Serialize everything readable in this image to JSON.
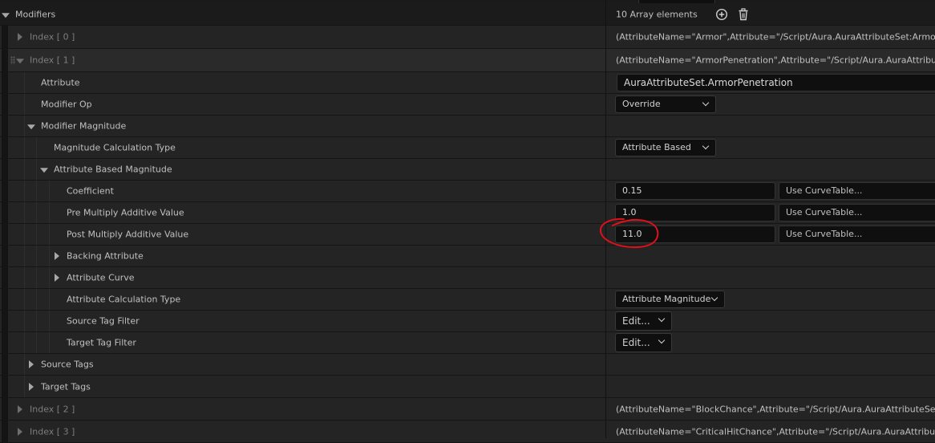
{
  "modifiers": {
    "label": "Modifiers",
    "count_text": "10 Array elements",
    "add_icon": "plus-circle-icon",
    "delete_icon": "trash-icon"
  },
  "index0": {
    "label": "Index [ 0 ]",
    "value": "(AttributeName=\"Armor\",Attribute=\"/Script/Aura.AuraAttributeSet:Armor\",Attrib"
  },
  "index1": {
    "label": "Index [ 1 ]",
    "value": "(AttributeName=\"ArmorPenetration\",Attribute=\"/Script/Aura.AuraAttributeSet:A"
  },
  "attribute": {
    "label": "Attribute",
    "value": "AuraAttributeSet.ArmorPenetration"
  },
  "modifier_op": {
    "label": "Modifier Op",
    "value": "Override"
  },
  "modifier_magnitude": {
    "label": "Modifier Magnitude"
  },
  "mag_calc_type": {
    "label": "Magnitude Calculation Type",
    "value": "Attribute Based"
  },
  "attr_based_mag": {
    "label": "Attribute Based Magnitude"
  },
  "coefficient": {
    "label": "Coefficient",
    "value": "0.15",
    "curve": "Use CurveTable..."
  },
  "pre_mult": {
    "label": "Pre Multiply Additive Value",
    "value": "1.0",
    "curve": "Use CurveTable..."
  },
  "post_mult": {
    "label": "Post Multiply Additive Value",
    "value": "11.0",
    "curve": "Use CurveTable..."
  },
  "backing_attribute": {
    "label": "Backing Attribute"
  },
  "attribute_curve": {
    "label": "Attribute Curve"
  },
  "attr_calc_type": {
    "label": "Attribute Calculation Type",
    "value": "Attribute Magnitude"
  },
  "source_tag_filter": {
    "label": "Source Tag Filter",
    "value": "Edit..."
  },
  "target_tag_filter": {
    "label": "Target Tag Filter",
    "value": "Edit..."
  },
  "source_tags": {
    "label": "Source Tags"
  },
  "target_tags": {
    "label": "Target Tags"
  },
  "index2": {
    "label": "Index [ 2 ]",
    "value": "(AttributeName=\"BlockChance\",Attribute=\"/Script/Aura.AuraAttributeSet:BlockC"
  },
  "index3": {
    "label": "Index [ 3 ]",
    "value": "(AttributeName=\"CriticalHitChance\",Attribute=\"/Script/Aura.AuraAttributeSet:Cr"
  },
  "colors": {
    "annotation": "#e0101a",
    "panel": "#242424",
    "field": "#0f0f0f"
  }
}
